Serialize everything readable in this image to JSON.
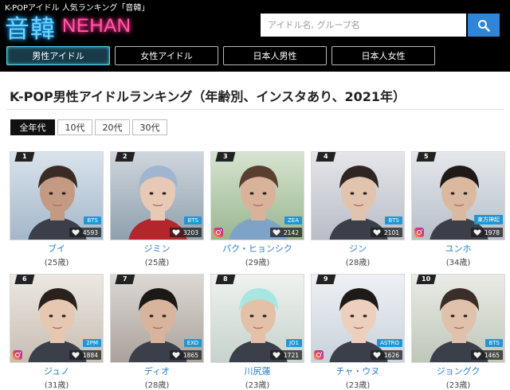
{
  "header": {
    "tagline": "K-POPアイドル 人気ランキング「音韓」",
    "logo_kanji": "音韓",
    "logo_en": "NEHAN",
    "search_placeholder": "アイドル名, グループ名",
    "search_icon": "search-icon",
    "nav": [
      {
        "label": "男性アイドル",
        "active": true
      },
      {
        "label": "女性アイドル",
        "active": false
      },
      {
        "label": "日本人男性",
        "active": false
      },
      {
        "label": "日本人女性",
        "active": false
      }
    ]
  },
  "title": "K-POP男性アイドルランキング（年齢別、インスタあり、2021年）",
  "filters": [
    {
      "label": "全年代",
      "active": true
    },
    {
      "label": "10代",
      "active": false
    },
    {
      "label": "20代",
      "active": false
    },
    {
      "label": "30代",
      "active": false
    }
  ],
  "cards": [
    {
      "rank": "1",
      "group": "BTS",
      "likes": "4593",
      "name": "ブイ",
      "age": "(25歳)",
      "instagram": false
    },
    {
      "rank": "2",
      "group": "BTS",
      "likes": "3203",
      "name": "ジミン",
      "age": "(25歳)",
      "instagram": false
    },
    {
      "rank": "3",
      "group": "ZEA",
      "likes": "2142",
      "name": "パク・ヒョンシク",
      "age": "(29歳)",
      "instagram": true
    },
    {
      "rank": "4",
      "group": "BTS",
      "likes": "2101",
      "name": "ジン",
      "age": "(28歳)",
      "instagram": false
    },
    {
      "rank": "5",
      "group": "東方神起",
      "likes": "1978",
      "name": "ユンホ",
      "age": "(34歳)",
      "instagram": true
    },
    {
      "rank": "6",
      "group": "2PM",
      "likes": "1884",
      "name": "ジュノ",
      "age": "(31歳)",
      "instagram": true
    },
    {
      "rank": "7",
      "group": "EXO",
      "likes": "1865",
      "name": "ディオ",
      "age": "(28歳)",
      "instagram": false
    },
    {
      "rank": "8",
      "group": "JO1",
      "likes": "1721",
      "name": "川尻蓮",
      "age": "(23歳)",
      "instagram": false
    },
    {
      "rank": "9",
      "group": "ASTRO",
      "likes": "1626",
      "name": "チャ・ウヌ",
      "age": "(23歳)",
      "instagram": true
    },
    {
      "rank": "10",
      "group": "BTS",
      "likes": "1465",
      "name": "ジョングク",
      "age": "(23歳)",
      "instagram": false
    }
  ],
  "colors": {
    "accent_blue": "#2f86d8",
    "name_link": "#2a7ec8",
    "group_badge": "#2196d3",
    "logo_cyan": "#6fd3ff",
    "logo_pink": "#ff5aa8"
  }
}
